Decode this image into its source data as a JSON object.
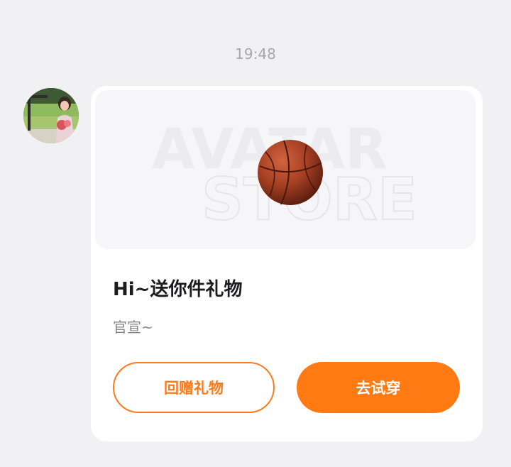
{
  "chat": {
    "timestamp": "19:48"
  },
  "sender": {
    "avatar_icon": "user-photo-avatar"
  },
  "gift_card": {
    "watermark_line1": "AVATAR",
    "watermark_line2": "STORE",
    "gift_icon": "basketball-icon",
    "title": "Hi~送你件礼物",
    "subtitle": "官宣~",
    "return_gift_label": "回赠礼物",
    "try_on_label": "去试穿"
  },
  "colors": {
    "accent": "#ff7a12",
    "background": "#f1f1f3",
    "card": "#ffffff"
  }
}
